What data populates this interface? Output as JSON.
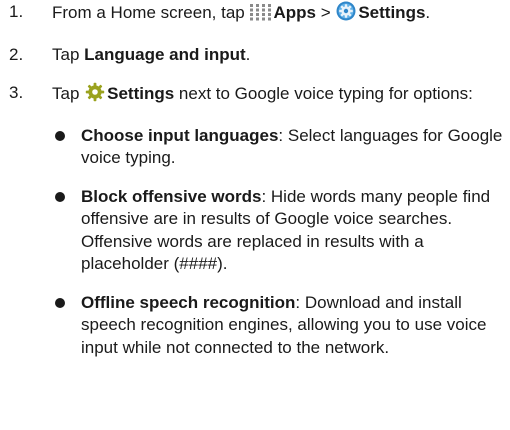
{
  "steps": [
    {
      "number": "1.",
      "text_before": "From a Home screen, tap ",
      "apps_icon": "apps-grid-icon",
      "apps_label": "Apps",
      "separator": " > ",
      "settings_icon": "settings-gear-icon",
      "settings_label": "Settings",
      "text_after": "."
    },
    {
      "number": "2.",
      "text_before": "Tap ",
      "bold": "Language and input",
      "text_after": "."
    },
    {
      "number": "3.",
      "text_before": "Tap ",
      "settings_icon": "settings-cog-icon",
      "bold": "Settings",
      "text_after": " next to Google voice typing for options:",
      "bullets": [
        {
          "term": "Choose input languages",
          "desc": ": Select languages for Google voice typing."
        },
        {
          "term": "Block offensive words",
          "desc": ": Hide words many people find offensive are in results of Google voice searches. Offensive words are replaced in results with a placeholder (####)."
        },
        {
          "term": "Offline speech recognition",
          "desc": ": Download and install speech recognition engines, allowing you to use voice input while not connected to the network."
        }
      ]
    }
  ],
  "colors": {
    "text": "#1a1a1a",
    "apps_icon": "#8a8a8a",
    "settings_icon_blue": "#2f86c9",
    "settings_cog": "#9aa21e"
  }
}
